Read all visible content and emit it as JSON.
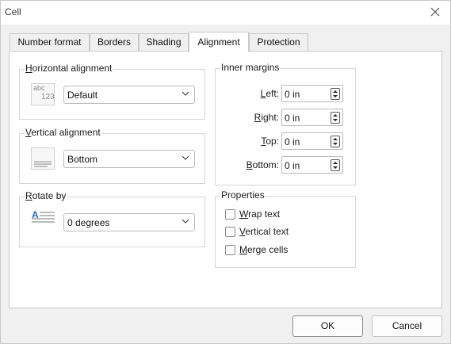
{
  "window": {
    "title": "Cell"
  },
  "tabs": [
    {
      "label": "Number format"
    },
    {
      "label": "Borders"
    },
    {
      "label": "Shading"
    },
    {
      "label": "Alignment"
    },
    {
      "label": "Protection"
    }
  ],
  "horizontal": {
    "label_mn": "H",
    "label_rest": "orizontal alignment",
    "icon_text_top": "abc",
    "icon_text_bottom": "123",
    "value": "Default"
  },
  "vertical": {
    "label_mn": "V",
    "label_rest": "ertical alignment",
    "value": "Bottom"
  },
  "rotate": {
    "label_mn": "R",
    "label_rest": "otate by",
    "icon_letter": "A",
    "value": "0 degrees"
  },
  "margins": {
    "label": "Inner margins",
    "items": [
      {
        "mn": "L",
        "rest": "eft:",
        "value": "0 in"
      },
      {
        "mn": "R",
        "rest": "ight:",
        "value": "0 in"
      },
      {
        "mn": "T",
        "rest": "op:",
        "value": "0 in"
      },
      {
        "mn": "B",
        "rest": "ottom:",
        "value": "0 in"
      }
    ]
  },
  "properties": {
    "label": "Properties",
    "items": [
      {
        "mn": "W",
        "rest": "rap text",
        "checked": false
      },
      {
        "mn": "V",
        "rest": "ertical text",
        "checked": false
      },
      {
        "mn": "M",
        "rest": "erge cells",
        "checked": false
      }
    ]
  },
  "buttons": {
    "ok": "OK",
    "cancel": "Cancel"
  },
  "colors": {
    "accent": "#0067c0",
    "border": "#c9c9c9"
  }
}
